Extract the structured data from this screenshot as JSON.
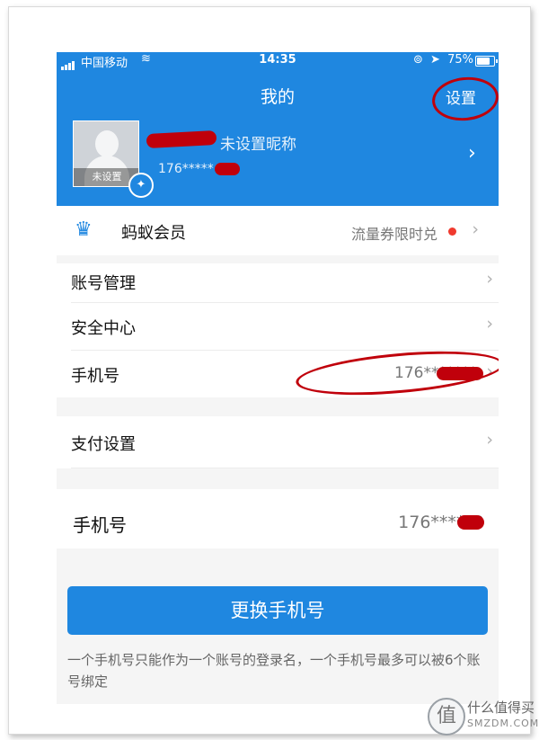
{
  "status_bar": {
    "carrier": "中国移动",
    "time": "14:35",
    "battery": "75%",
    "battery_level": 0.75
  },
  "header": {
    "title": "我的",
    "settings_label": "设置"
  },
  "profile": {
    "avatar_label": "未设置",
    "nickname": "未设置昵称",
    "phone": "176*****"
  },
  "member_row": {
    "label": "蚂蚁会员",
    "promo": "流量券限时兑"
  },
  "account_rows": [
    {
      "label": "账号管理"
    },
    {
      "label": "安全中心"
    },
    {
      "label": "手机号",
      "value": "176*******"
    }
  ],
  "payment_row": {
    "label": "支付设置"
  },
  "phone_panel": {
    "label": "手机号",
    "value": "176*****0"
  },
  "change_button": "更换手机号",
  "note": "一个手机号只能作为一个账号的登录名，一个手机号最多可以被6个账号绑定",
  "watermark": {
    "line1": "什么值得买",
    "line2": "SMZDM.COM"
  },
  "colors": {
    "brand_blue": "#1f87e0",
    "annotation_red": "#c0000b",
    "promo_dot": "#f03a2e"
  }
}
